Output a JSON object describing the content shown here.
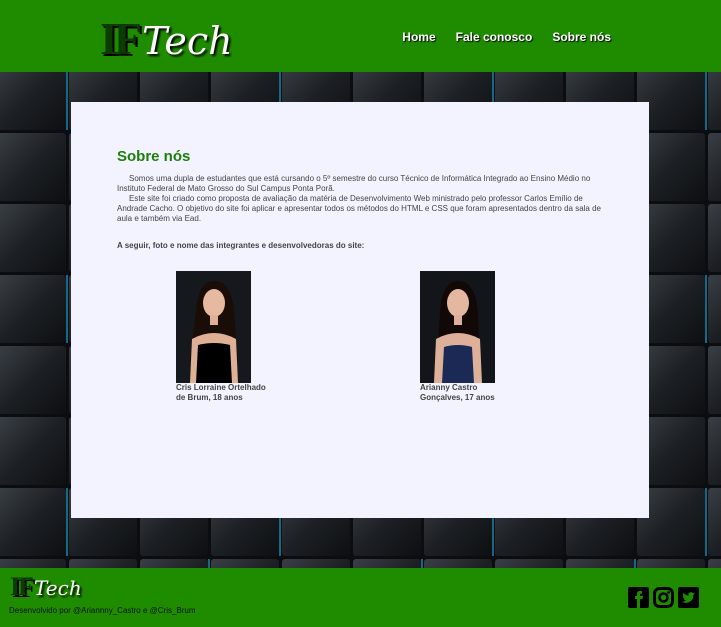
{
  "brand": {
    "if": "IF",
    "tech": "Tech"
  },
  "nav": [
    {
      "label": "Home"
    },
    {
      "label": "Fale conosco"
    },
    {
      "label": "Sobre nós"
    }
  ],
  "main": {
    "title": "Sobre nós",
    "paragraph1": "Somos uma dupla de estudantes que está cursando o 5º semestre do curso Técnico de Informática Integrado ao Ensino Médio no Instituto Federal de Mato Grosso do Sul Campus Ponta Porã.",
    "paragraph2": "Este site foi criado como proposta de avaliação da matéria de Desenvolvimento Web ministrado pelo professor Carlos Emílio de Andrade Cacho. O objetivo do site foi aplicar e apresentar todos os métodos do HTML e CSS que foram apresentados dentro da sala de aula e também via Ead.",
    "lead": "A seguir, foto e nome das integrantes e desenvolvedoras do site:",
    "members": [
      {
        "line1": "Cris Lorraine Ortelhado",
        "line2": "de Brum, 18 anos",
        "top_color": "#000000"
      },
      {
        "line1": "Arianny Castro",
        "line2": "Gonçalves, 17 anos",
        "top_color": "#1b2a55"
      }
    ]
  },
  "footer": {
    "credit": "Desenvolvido por @Ariannny_Castro e @Cris_Brum",
    "social": [
      "facebook-icon",
      "instagram-icon",
      "twitter-icon"
    ]
  },
  "colors": {
    "brand_green": "#1f8c00",
    "title_green": "#1d7e0a",
    "card_bg": "#f3f3ff"
  }
}
